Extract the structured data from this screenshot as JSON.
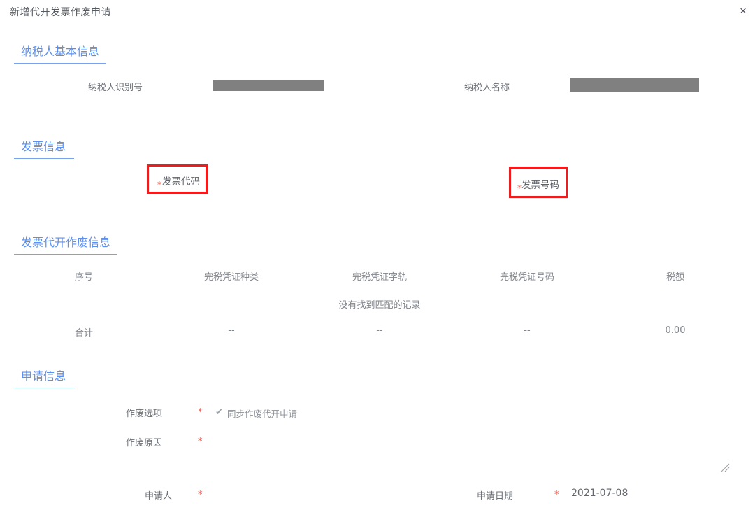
{
  "dialog": {
    "title": "新增代开发票作废申请",
    "close_icon": "×"
  },
  "sections": {
    "taxpayer": {
      "heading": "纳税人基本信息",
      "fields": [
        {
          "label": "纳税人识别号",
          "value": "",
          "redacted": true
        },
        {
          "label": "纳税人名称",
          "value": "",
          "redacted": true
        }
      ]
    },
    "invoice": {
      "heading": "发票信息",
      "highlighted_fields": [
        {
          "label": "发票代码",
          "required_mark": "*"
        },
        {
          "label": "发票号码",
          "required_mark": "*"
        }
      ]
    },
    "invoice_void": {
      "heading": "发票代开作废信息",
      "table": {
        "columns": [
          "序号",
          "完税凭证种类",
          "完税凭证字轨",
          "完税凭证号码",
          "税额"
        ],
        "empty_text": "没有找到匹配的记录",
        "rows": [],
        "total_row": [
          "合计",
          "--",
          "--",
          "--",
          "0.00"
        ]
      }
    },
    "application": {
      "heading": "申请信息",
      "void_option": {
        "label": "作废选项",
        "required_mark": "*",
        "checkbox_icon": "✔",
        "checkbox_label": "同步作废代开申请",
        "checked": true
      },
      "void_reason": {
        "label": "作废原因",
        "required_mark": "*",
        "value": "",
        "placeholder": ""
      },
      "applicant": {
        "label": "申请人",
        "required_mark": "*",
        "value": ""
      },
      "apply_date": {
        "label": "申请日期",
        "required_mark": "*",
        "value": "2021-07-08"
      }
    }
  },
  "colors": {
    "accent": "#5b8ff0",
    "required": "#f05a4f",
    "highlight_box": "#ee1c1c",
    "redaction": "#808080",
    "text": "#6b6f76"
  }
}
